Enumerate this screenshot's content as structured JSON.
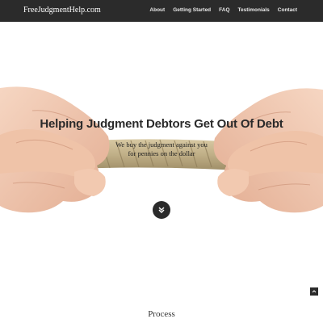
{
  "site": {
    "brand": "FreeJudgmentHelp.com"
  },
  "nav": {
    "items": [
      "About",
      "Getting Started",
      "FAQ",
      "Testimonials",
      "Contact"
    ]
  },
  "hero": {
    "headline": "Helping Judgment Debtors Get Out Of Debt",
    "subline_1": "We buy the judgment against you",
    "subline_2": "for pennies on the dollar",
    "image": "hands-pulling-rope",
    "scroll_icon": "double-chevron-down-icon"
  },
  "back_to_top": {
    "icon": "chevron-up-icon"
  },
  "section": {
    "title": "Process"
  },
  "colors": {
    "navbar": "#2b2b2b",
    "text": "#2a2a2a",
    "skin": "#f0c7ad",
    "rope": "#c9b78e"
  }
}
